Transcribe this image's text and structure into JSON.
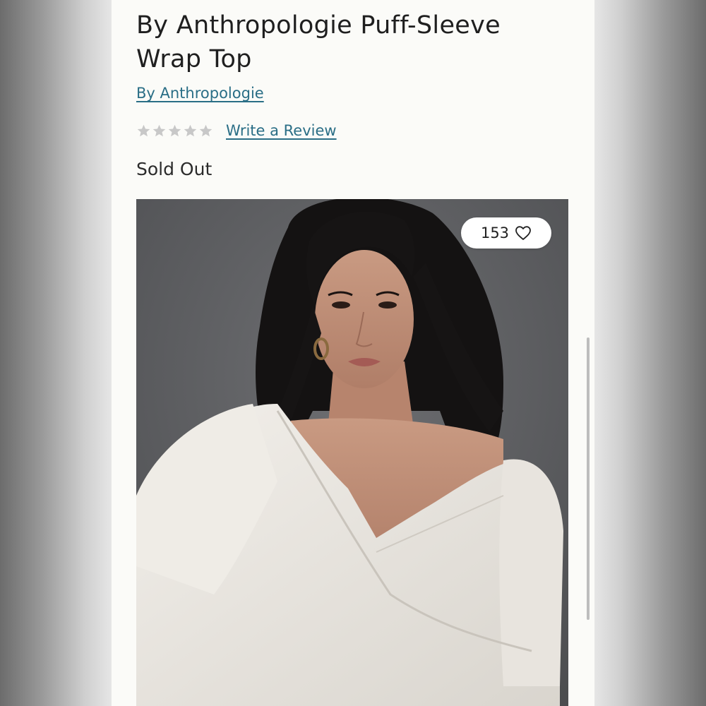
{
  "product": {
    "title": "By Anthropologie Puff-Sleeve Wrap Top",
    "brand_link": "By Anthropologie",
    "rating": {
      "stars_filled": 0,
      "stars_total": 5,
      "write_review_label": "Write a Review"
    },
    "availability": "Sold Out",
    "image": {
      "like_count": "153",
      "like_icon": "heart-outline-icon"
    }
  },
  "colors": {
    "link": "#2a6e86",
    "text": "#1f1f1f",
    "star_empty": "#c8c8c8",
    "page_bg": "#fbfbf8"
  }
}
